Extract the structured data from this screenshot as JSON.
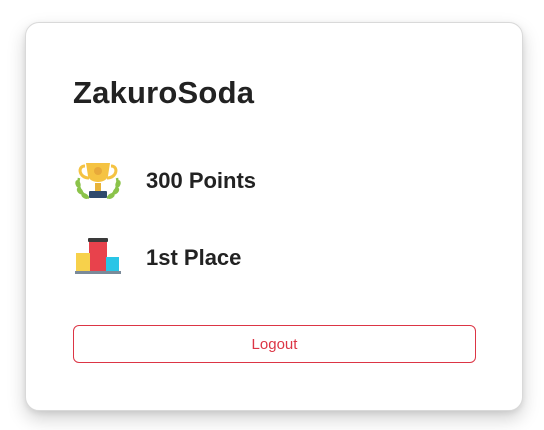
{
  "profile": {
    "username": "ZakuroSoda"
  },
  "stats": {
    "points_label": "300 Points",
    "place_label": "1st Place",
    "points_icon": "trophy-icon",
    "place_icon": "podium-icon"
  },
  "actions": {
    "logout_label": "Logout"
  },
  "colors": {
    "danger": "#dc3545",
    "text": "#222222",
    "trophy_gold": "#f5c342",
    "laurel_green": "#8bc34a",
    "podium_red": "#e8424c",
    "podium_yellow": "#f7d14b",
    "podium_cyan": "#29c5e6"
  }
}
